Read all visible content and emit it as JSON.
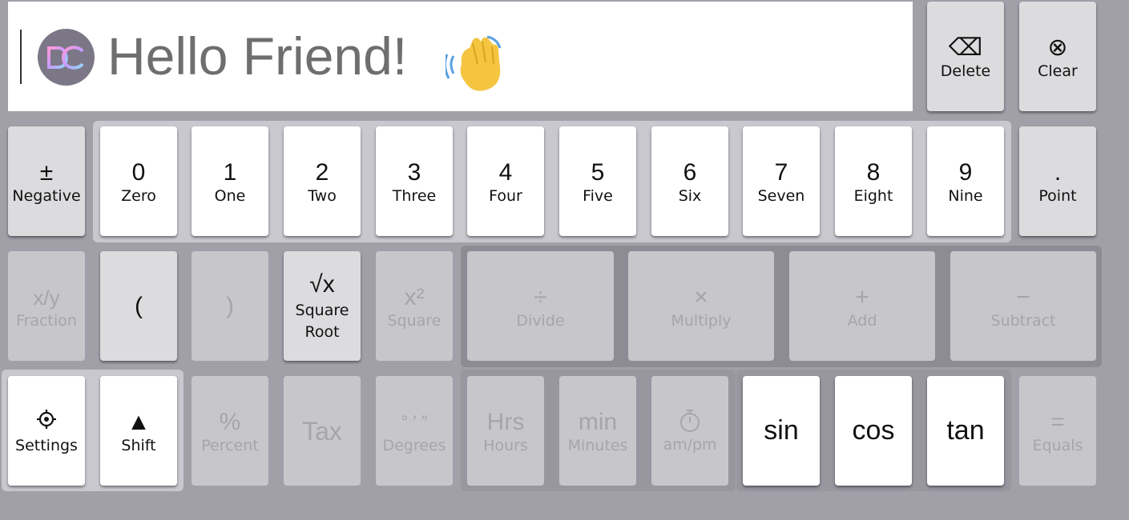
{
  "display": {
    "greeting": "Hello Friend!",
    "logo_text": "DC",
    "wave_icon": "waving-hand-emoji"
  },
  "top_keys": {
    "delete": {
      "sym": "⌫",
      "label": "Delete"
    },
    "clear": {
      "sym": "⊗",
      "label": "Clear"
    }
  },
  "row1": {
    "negative": {
      "sym": "±",
      "label": "Negative"
    },
    "digits": [
      {
        "sym": "0",
        "label": "Zero"
      },
      {
        "sym": "1",
        "label": "One"
      },
      {
        "sym": "2",
        "label": "Two"
      },
      {
        "sym": "3",
        "label": "Three"
      },
      {
        "sym": "4",
        "label": "Four"
      },
      {
        "sym": "5",
        "label": "Five"
      },
      {
        "sym": "6",
        "label": "Six"
      },
      {
        "sym": "7",
        "label": "Seven"
      },
      {
        "sym": "8",
        "label": "Eight"
      },
      {
        "sym": "9",
        "label": "Nine"
      }
    ],
    "point": {
      "sym": ".",
      "label": "Point"
    }
  },
  "row2": {
    "fraction": {
      "sym": "x/y",
      "label": "Fraction"
    },
    "open_paren": {
      "sym": "("
    },
    "close_paren": {
      "sym": ")"
    },
    "sqrt": {
      "sym": "√x",
      "label": "Square Root"
    },
    "square": {
      "sym": "x²",
      "label": "Square"
    },
    "divide": {
      "sym": "÷",
      "label": "Divide"
    },
    "multiply": {
      "sym": "×",
      "label": "Multiply"
    },
    "add": {
      "sym": "+",
      "label": "Add"
    },
    "subtract": {
      "sym": "−",
      "label": "Subtract"
    }
  },
  "row3": {
    "settings": {
      "icon": "gear-icon",
      "label": "Settings"
    },
    "shift": {
      "sym": "▲",
      "label": "Shift"
    },
    "percent": {
      "sym": "%",
      "label": "Percent"
    },
    "tax": {
      "sym": "Tax"
    },
    "degrees": {
      "sym": "° ′ ″",
      "label": "Degrees"
    },
    "hours": {
      "sym": "Hrs",
      "label": "Hours"
    },
    "minutes": {
      "sym": "min",
      "label": "Minutes"
    },
    "ampm": {
      "icon": "stopwatch-icon",
      "label": "am/pm"
    },
    "sin": {
      "sym": "sin"
    },
    "cos": {
      "sym": "cos"
    },
    "tan": {
      "sym": "tan"
    },
    "equals": {
      "sym": "=",
      "label": "Equals"
    }
  }
}
